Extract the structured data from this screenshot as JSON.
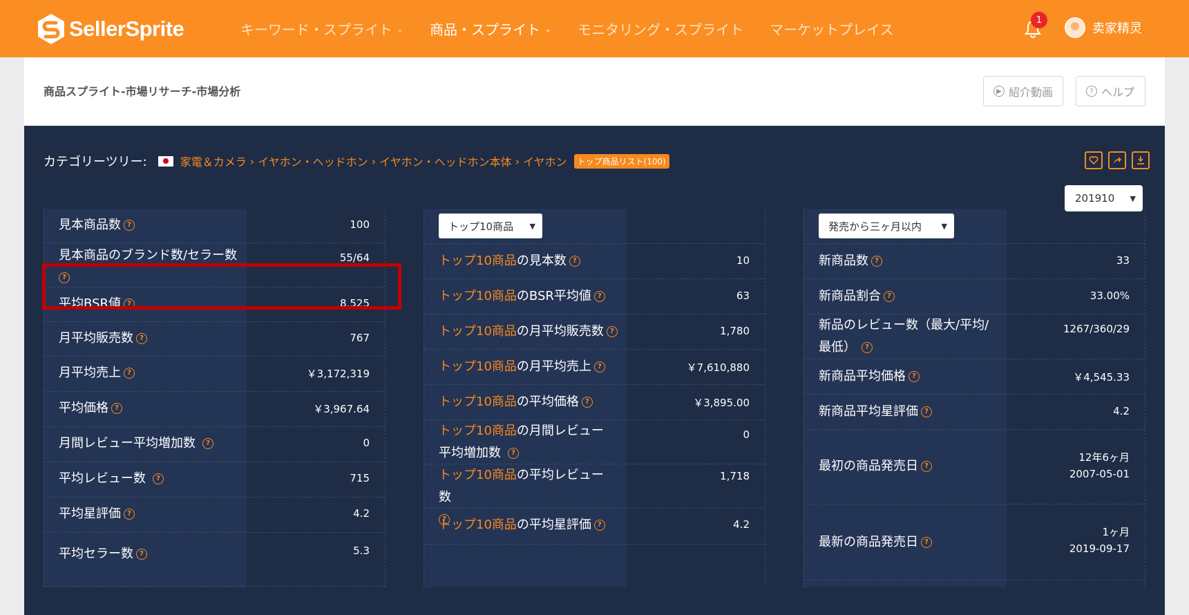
{
  "brand": {
    "name": "SellerSprite"
  },
  "nav": {
    "items": [
      {
        "label": "キーワード・スプライト",
        "caret": true,
        "active": false
      },
      {
        "label": "商品・スプライト",
        "caret": true,
        "active": true
      },
      {
        "label": "モニタリング・スプライト",
        "caret": false,
        "active": false
      },
      {
        "label": "マーケットプレイス",
        "caret": false,
        "active": false
      }
    ],
    "notification_count": "1",
    "username": "卖家精灵"
  },
  "header": {
    "title": "商品スプライト-市場リサーチ-市場分析",
    "video_button": "紹介動画",
    "help_button": "ヘルプ"
  },
  "category": {
    "label": "カテゴリーツリー:",
    "path": [
      "家電＆カメラ",
      "イヤホン・ヘッドホン",
      "イヤホン・ヘッドホン本体",
      "イヤホン"
    ],
    "separator": "›",
    "badge": "トップ商品リスト(100)"
  },
  "month_select": {
    "value": "201910"
  },
  "table1": {
    "rows": [
      {
        "label": "見本商品数",
        "value": "100"
      },
      {
        "label": "見本商品のブランド数/セラー数",
        "value": "55/64"
      },
      {
        "label": "平均BSR値",
        "value": "8,525"
      },
      {
        "label": "月平均販売数",
        "value": "767"
      },
      {
        "label": "月平均売上",
        "value": "￥3,172,319"
      },
      {
        "label": "平均価格",
        "value": "￥3,967.64"
      },
      {
        "label": "月間レビュー平均増加数",
        "value": "0"
      },
      {
        "label": "平均レビュー数",
        "value": "715"
      },
      {
        "label": "平均星評価",
        "value": "4.2"
      },
      {
        "label": "平均セラー数",
        "value": "5.3"
      }
    ]
  },
  "table2": {
    "select": "トップ10商品",
    "prefix": "トップ10商品",
    "rows": [
      {
        "label": "の見本数",
        "value": "10"
      },
      {
        "label": "のBSR平均値",
        "value": "63"
      },
      {
        "label": "の月平均販売数",
        "value": "1,780"
      },
      {
        "label": "の月平均売上",
        "value": "￥7,610,880"
      },
      {
        "label": "の平均価格",
        "value": "￥3,895.00"
      },
      {
        "label": "の月間レビュー平均増加数",
        "value": "0"
      },
      {
        "label": "の平均レビュー数",
        "value": "1,718"
      },
      {
        "label": "の平均星評価",
        "value": "4.2"
      }
    ]
  },
  "table3": {
    "select": "発売から三ヶ月以内",
    "rows": [
      {
        "label": "新商品数",
        "value": "33"
      },
      {
        "label": "新商品割合",
        "value": "33.00%"
      },
      {
        "label": "新品のレビュー数（最大/平均/最低）",
        "value": "1267/360/29"
      },
      {
        "label": "新商品平均価格",
        "value": "￥4,545.33"
      },
      {
        "label": "新商品平均星評価",
        "value": "4.2"
      },
      {
        "label": "最初の商品発売日",
        "value": "12年6ヶ月",
        "value2": "2007-05-01"
      },
      {
        "label": "最新の商品発売日",
        "value": "1ヶ月",
        "value2": "2019-09-17"
      }
    ]
  },
  "colors": {
    "nav_bg": "#fb8e22",
    "panel_bg": "#1e2c46",
    "accent": "#f68a1e",
    "highlight_box": "#c10000"
  }
}
